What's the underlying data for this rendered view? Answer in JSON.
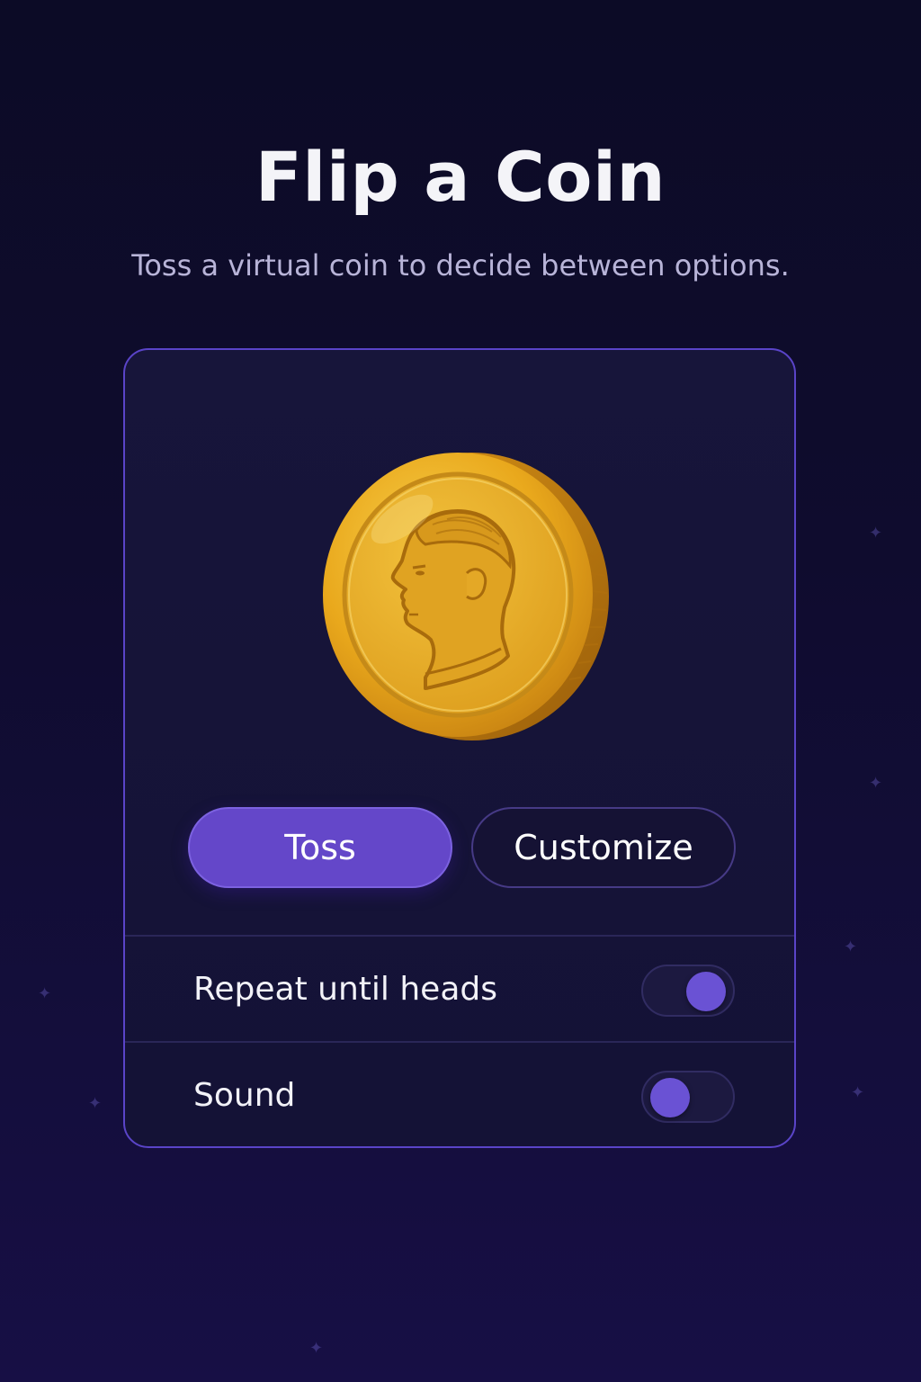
{
  "header": {
    "title": "Flip a Coin",
    "subtitle": "Toss a virtual coin to decide between options."
  },
  "coin": {
    "face": "heads",
    "icon": "coin-heads-portrait-icon",
    "color": "#e8a820"
  },
  "actions": {
    "toss_label": "Toss",
    "customize_label": "Customize"
  },
  "settings": [
    {
      "label": "Repeat until heads",
      "enabled": true
    },
    {
      "label": "Sound",
      "enabled": false
    }
  ],
  "colors": {
    "accent": "#6447c9",
    "card_border": "#5a44c8",
    "background": "#0c0b26"
  }
}
